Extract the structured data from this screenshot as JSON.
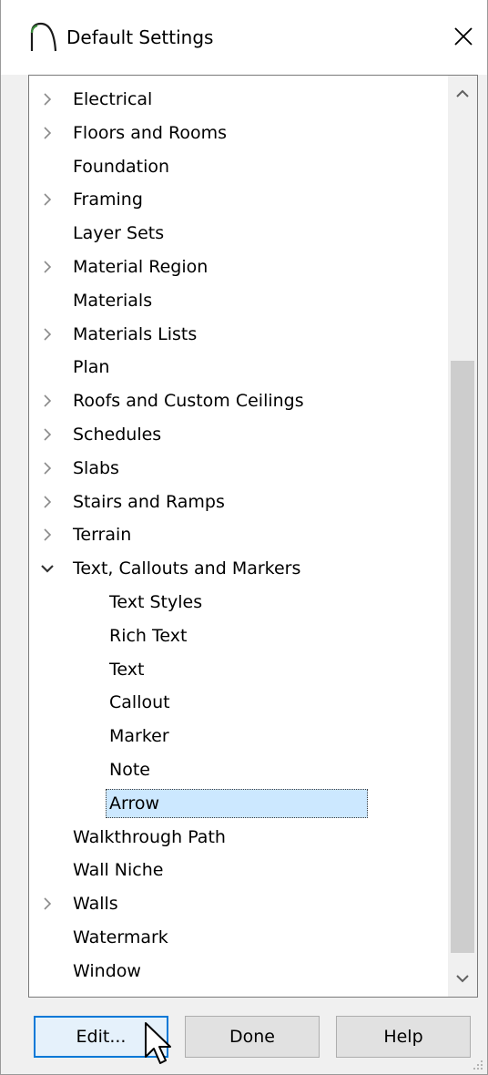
{
  "window": {
    "title": "Default Settings",
    "icons": {
      "app": "arch-icon",
      "close": "close-icon"
    }
  },
  "tree": {
    "items": [
      {
        "label": "Electrical",
        "level": 0,
        "expander": "collapsed"
      },
      {
        "label": "Floors and Rooms",
        "level": 0,
        "expander": "collapsed"
      },
      {
        "label": "Foundation",
        "level": 0,
        "expander": "none"
      },
      {
        "label": "Framing",
        "level": 0,
        "expander": "collapsed"
      },
      {
        "label": "Layer Sets",
        "level": 0,
        "expander": "none"
      },
      {
        "label": "Material Region",
        "level": 0,
        "expander": "collapsed"
      },
      {
        "label": "Materials",
        "level": 0,
        "expander": "none"
      },
      {
        "label": "Materials Lists",
        "level": 0,
        "expander": "collapsed"
      },
      {
        "label": "Plan",
        "level": 0,
        "expander": "none"
      },
      {
        "label": "Roofs and Custom Ceilings",
        "level": 0,
        "expander": "collapsed"
      },
      {
        "label": "Schedules",
        "level": 0,
        "expander": "collapsed"
      },
      {
        "label": "Slabs",
        "level": 0,
        "expander": "collapsed"
      },
      {
        "label": "Stairs and Ramps",
        "level": 0,
        "expander": "collapsed"
      },
      {
        "label": "Terrain",
        "level": 0,
        "expander": "collapsed"
      },
      {
        "label": "Text, Callouts and Markers",
        "level": 0,
        "expander": "expanded"
      },
      {
        "label": "Text Styles",
        "level": 1,
        "expander": "none"
      },
      {
        "label": "Rich Text",
        "level": 1,
        "expander": "none"
      },
      {
        "label": "Text",
        "level": 1,
        "expander": "none"
      },
      {
        "label": "Callout",
        "level": 1,
        "expander": "none"
      },
      {
        "label": "Marker",
        "level": 1,
        "expander": "none"
      },
      {
        "label": "Note",
        "level": 1,
        "expander": "none"
      },
      {
        "label": "Arrow",
        "level": 1,
        "expander": "none",
        "selected": true
      },
      {
        "label": "Walkthrough Path",
        "level": 0,
        "expander": "none"
      },
      {
        "label": "Wall Niche",
        "level": 0,
        "expander": "none"
      },
      {
        "label": "Walls",
        "level": 0,
        "expander": "collapsed"
      },
      {
        "label": "Watermark",
        "level": 0,
        "expander": "none"
      },
      {
        "label": "Window",
        "level": 0,
        "expander": "none"
      }
    ]
  },
  "buttons": {
    "edit": "Edit...",
    "done": "Done",
    "help": "Help"
  },
  "colors": {
    "selection": "#cce8ff",
    "default_button_border": "#0078d7"
  }
}
